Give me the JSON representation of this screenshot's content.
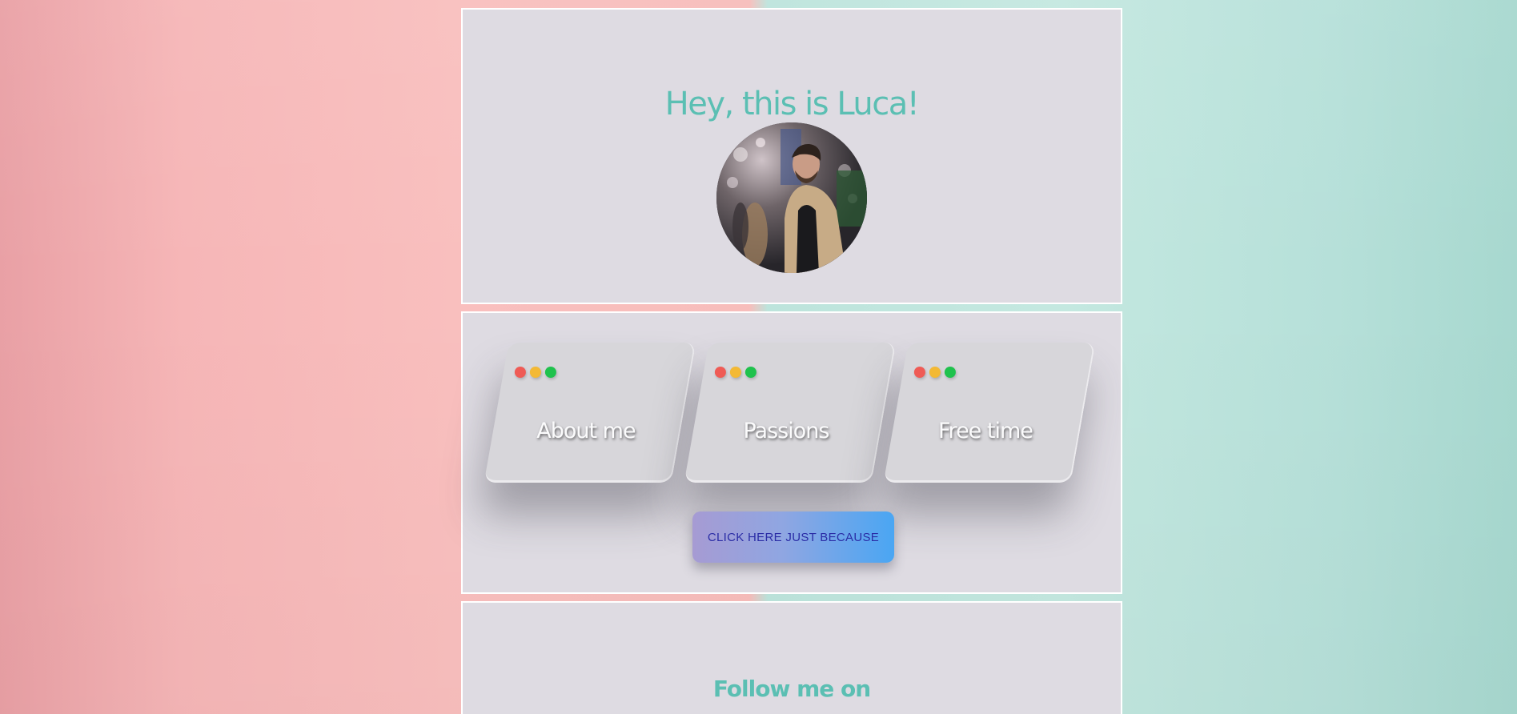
{
  "hero": {
    "title": "Hey, this is Luca!",
    "avatar_alt": "Photo of Luca"
  },
  "cards": [
    {
      "label": "About me"
    },
    {
      "label": "Passions"
    },
    {
      "label": "Free time"
    }
  ],
  "cta": {
    "label": "CLICK HERE JUST BECAUSE"
  },
  "follow": {
    "title": "Follow me on"
  },
  "colors": {
    "accent": "#5bbfb3",
    "panel": "#dedbe2",
    "dot_red": "#ef5b55",
    "dot_yellow": "#f3b935",
    "dot_green": "#1fc24d",
    "background_left": "#f7bdbb",
    "background_right": "#bde4dc"
  }
}
